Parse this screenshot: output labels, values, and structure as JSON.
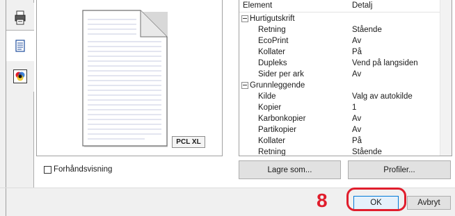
{
  "tabs": [
    {
      "icon": "printer-icon",
      "active": false
    },
    {
      "icon": "document-icon",
      "active": true
    },
    {
      "icon": "color-icon",
      "active": false
    }
  ],
  "preview": {
    "badge": "PCL XL",
    "checkbox_label": "Forhåndsvisning",
    "checkbox_checked": false
  },
  "props": {
    "col_element": "Element",
    "col_detail": "Detalj",
    "rows": [
      {
        "label": "Hurtigutskrift",
        "group": true
      },
      {
        "label": "Retning",
        "value": "Stående"
      },
      {
        "label": "EcoPrint",
        "value": "Av"
      },
      {
        "label": "Kollater",
        "value": "På"
      },
      {
        "label": "Dupleks",
        "value": "Vend på langsiden"
      },
      {
        "label": "Sider per ark",
        "value": "Av"
      },
      {
        "label": "Grunnleggende",
        "group": true
      },
      {
        "label": "Kilde",
        "value": "Valg av autokilde"
      },
      {
        "label": "Kopier",
        "value": "1"
      },
      {
        "label": "Karbonkopier",
        "value": "Av"
      },
      {
        "label": "Partikopier",
        "value": "Av"
      },
      {
        "label": "Kollater",
        "value": "På"
      },
      {
        "label": "Retning",
        "value": "Stående"
      }
    ]
  },
  "buttons": {
    "save_as": "Lagre som...",
    "profiles": "Profiler...",
    "ok": "OK",
    "cancel": "Avbryt"
  },
  "annotation": {
    "step": "8",
    "color": "#e01d2c"
  }
}
